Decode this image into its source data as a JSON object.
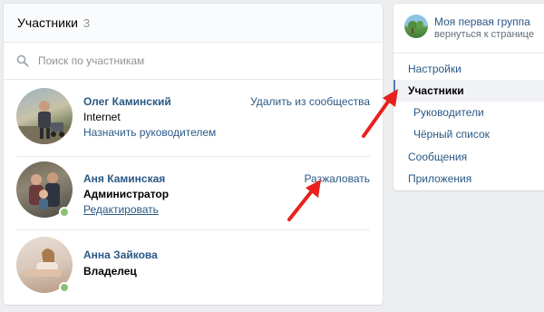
{
  "members_card": {
    "title": "Участники",
    "count": "3",
    "search_placeholder": "Поиск по участникам",
    "members": [
      {
        "name": "Олег Каминский",
        "line1": "Internet",
        "line2": "Назначить руководителем",
        "action": "Удалить из сообщества",
        "online": false
      },
      {
        "name": "Аня Каминская",
        "line1": "Администратор",
        "line2": "Редактировать",
        "action": "Разжаловать",
        "online": true
      },
      {
        "name": "Анна Зайкова",
        "line1": "Владелец",
        "line2": "",
        "action": "",
        "online": true
      }
    ]
  },
  "sidebar": {
    "group_name": "Моя первая группа",
    "group_back": "вернуться к странице",
    "menu": [
      {
        "label": "Настройки",
        "active": false
      },
      {
        "label": "Участники",
        "active": true
      },
      {
        "label": "Руководители",
        "active": false
      },
      {
        "label": "Чёрный список",
        "active": false
      },
      {
        "label": "Сообщения",
        "active": false
      },
      {
        "label": "Приложения",
        "active": false
      }
    ]
  },
  "colors": {
    "link": "#2a5885",
    "online": "#8ac176",
    "arrow": "#e8211c",
    "active_marker": "#5181b8"
  }
}
